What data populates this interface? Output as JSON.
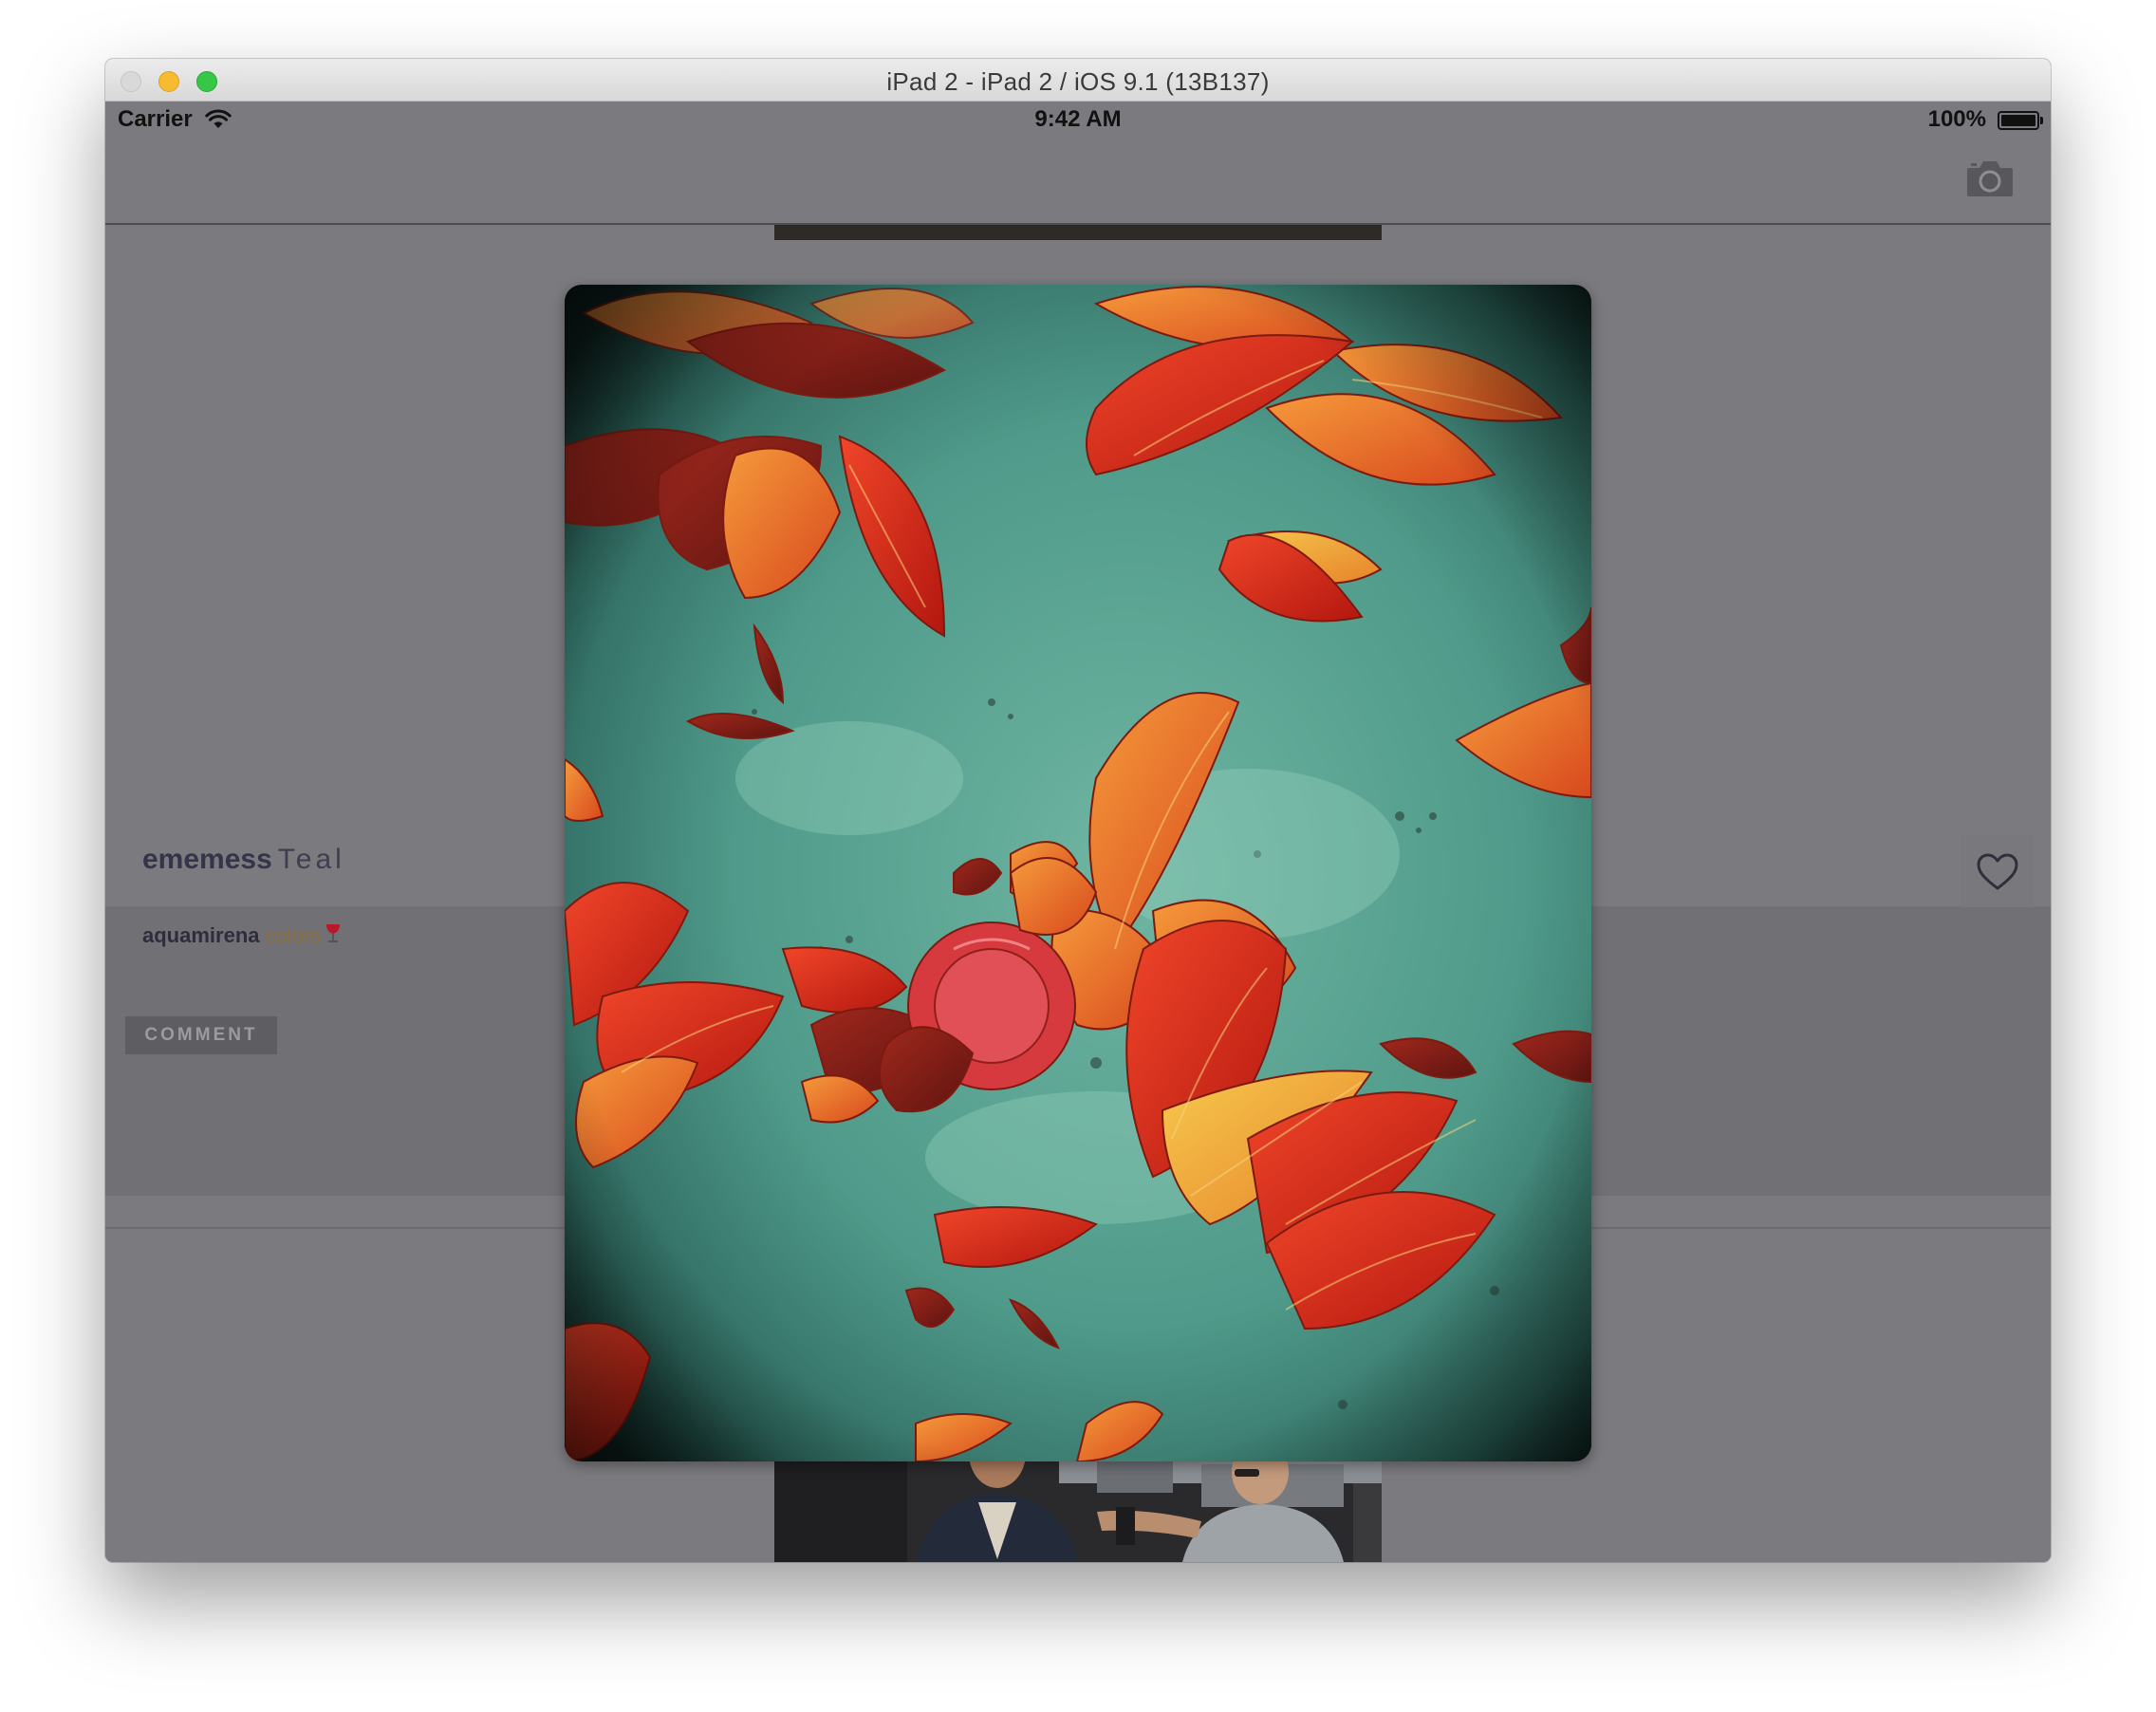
{
  "window": {
    "title": "iPad 2 - iPad 2 / iOS 9.1 (13B137)"
  },
  "statusbar": {
    "carrier": "Carrier",
    "time": "9:42 AM",
    "battery_label": "100%",
    "battery_level": 1.0
  },
  "navbar": {
    "camera_icon": "camera-icon"
  },
  "post": {
    "username": "ememess",
    "title": "Teal",
    "like_icon": "heart-icon",
    "comment": {
      "user": "aquamirena",
      "text": "colors",
      "emoji_icon": "wine-glass-icon"
    },
    "comment_button_label": "COMMENT"
  },
  "colors": {
    "screen_bg": "#7b7b7f",
    "teal": "#4f9a8a",
    "leaf_red": "#d7281a",
    "leaf_orange": "#ef7b26"
  }
}
